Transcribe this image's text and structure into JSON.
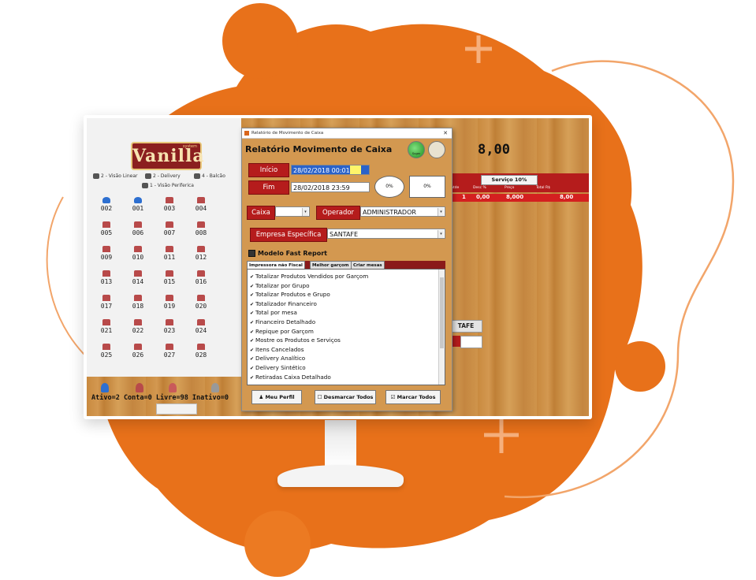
{
  "colors": {
    "accent": "#e8711a",
    "brand_red": "#b51c1c",
    "wood": "#c98a3f"
  },
  "left_panel": {
    "logo_text": "Vanilla",
    "logo_small": "system",
    "modes": [
      {
        "label": "2 - Visão Linear",
        "icon": "linear-view-icon"
      },
      {
        "label": "2 - Delivery",
        "icon": "delivery-icon"
      },
      {
        "label": "4 - Balcão",
        "icon": "counter-icon"
      },
      {
        "label": "1 - Visão Periferica",
        "icon": "peripheral-view-icon"
      }
    ],
    "tables": [
      "002",
      "001",
      "003",
      "004",
      "005",
      "006",
      "007",
      "008",
      "009",
      "010",
      "011",
      "012",
      "013",
      "014",
      "015",
      "016",
      "017",
      "018",
      "019",
      "020",
      "021",
      "022",
      "023",
      "024",
      "025",
      "026",
      "027",
      "028"
    ],
    "status": "Ativo=2   Conta=0   Livre=98   Inativo=0"
  },
  "main": {
    "total": "8,00",
    "service_button": "Serviço 10%",
    "columns": [
      "ntde",
      "Desc %",
      "Preço",
      "Total R$"
    ],
    "row": {
      "qty": "1",
      "desc": "0,00",
      "price": "8,000",
      "total": "8,00"
    },
    "company_short": "TAFE",
    "small_label": "s"
  },
  "dialog": {
    "window_title": "Relatório de Movimento de Caixa",
    "heading": "Relatório Movimento de Caixa",
    "btn_go_caption": "Sugar",
    "inicio_label": "Início",
    "inicio_value": "28/02/2018 00:01",
    "fim_label": "Fim",
    "fim_value": "28/02/2018 23:59",
    "pct_circle": "0%",
    "pct_box": "0%",
    "caixa_label": "Caixa",
    "caixa_value": "",
    "operador_label": "Operador",
    "operador_value": "ADMINISTRADOR",
    "empresa_label": "Empresa Específica",
    "empresa_value": "SANTAFE",
    "fast_report_label": "Modelo Fast Report",
    "tabs": [
      "Impressora não Fiscal",
      "Melhor garçom",
      "Criar mesas"
    ],
    "options": [
      "Totalizar Produtos Vendidos por Garçom",
      "Totalizar por Grupo",
      "Totalizar Produtos e Grupo",
      "Totalizador Financeiro",
      "Total por mesa",
      "Financeiro Detalhado",
      "Repique por Garçom",
      "Mostre os Produtos e Serviços",
      "Itens Cancelados",
      "Delivery Analítico",
      "Delivery Sintético",
      "Retiradas Caixa Detalhado"
    ],
    "buttons": {
      "profile": "Meu Perfil",
      "uncheck": "Desmarcar Todos",
      "check": "Marcar Todos"
    }
  }
}
